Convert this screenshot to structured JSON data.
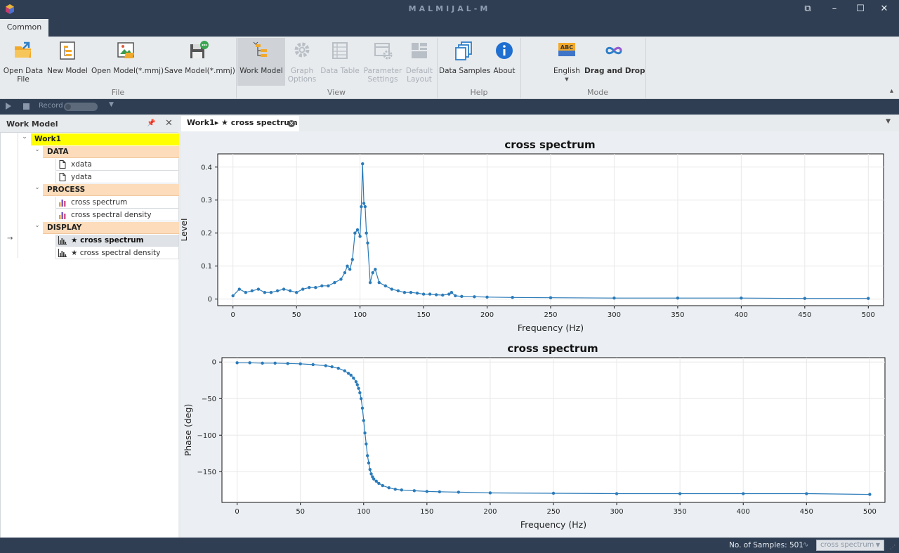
{
  "window": {
    "title": "MALMIJAL-M"
  },
  "ribbon": {
    "tab": "Common",
    "groups": {
      "file": "File",
      "view": "View",
      "help": "Help",
      "mode": "Mode"
    },
    "buttons": {
      "open_data_file": "Open Data\nFile",
      "new_model": "New Model",
      "open_model": "Open Model(*.mmj)",
      "save_model": "Save Model(*.mmj)",
      "work_model": "Work Model",
      "graph_options": "Graph\nOptions",
      "data_table": "Data Table",
      "parameter_settings": "Parameter\nSettings",
      "default_layout": "Default\nLayout",
      "data_samples": "Data Samples",
      "about": "About",
      "english": "English",
      "drag_and_drop": "Drag and Drop",
      "english_badge": "ABC"
    }
  },
  "record_bar": {
    "record_label": "Record"
  },
  "work_model_panel": {
    "title": "Work Model",
    "root": "Work1",
    "groups": [
      {
        "label": "DATA",
        "items": [
          "xdata",
          "ydata"
        ]
      },
      {
        "label": "PROCESS",
        "items": [
          "cross spectrum",
          "cross spectral density"
        ]
      },
      {
        "label": "DISPLAY",
        "items": [
          "★ cross spectrum",
          "★ cross spectral density"
        ]
      }
    ]
  },
  "document": {
    "tab_label": "Work1▸ ★ cross spectrum"
  },
  "status": {
    "samples": "No. of Samples: 501",
    "display_select": "cross spectrum"
  },
  "colors": {
    "titlebar": "#2f3e53",
    "ribbon": "#e8ebee",
    "series": "#2b7bb9",
    "root_highlight": "#ffff00",
    "group_highlight": "#fcdcba"
  },
  "chart_data": [
    {
      "type": "line",
      "title": "cross spectrum",
      "xlabel": "Frequency (Hz)",
      "ylabel": "Level",
      "xlim": [
        -12,
        512
      ],
      "ylim": [
        -0.02,
        0.44
      ],
      "xticks": [
        0,
        50,
        100,
        150,
        200,
        250,
        300,
        350,
        400,
        450,
        500
      ],
      "yticks": [
        0,
        0.1,
        0.2,
        0.3,
        0.4
      ],
      "ytick_labels": [
        "0",
        "0.1",
        "0.2",
        "0.3",
        "0.4"
      ],
      "grid": true,
      "markers": true,
      "x": [
        0,
        5,
        10,
        15,
        20,
        25,
        30,
        35,
        40,
        45,
        50,
        55,
        60,
        65,
        70,
        75,
        80,
        85,
        88,
        90,
        92,
        94,
        96,
        98,
        100,
        101,
        102,
        103,
        104,
        105,
        106,
        108,
        110,
        112,
        115,
        120,
        125,
        130,
        135,
        140,
        145,
        150,
        155,
        160,
        165,
        170,
        172,
        175,
        180,
        190,
        200,
        220,
        250,
        300,
        350,
        400,
        450,
        500
      ],
      "y": [
        0.01,
        0.03,
        0.02,
        0.025,
        0.03,
        0.02,
        0.02,
        0.025,
        0.03,
        0.025,
        0.02,
        0.03,
        0.035,
        0.035,
        0.04,
        0.04,
        0.05,
        0.06,
        0.08,
        0.1,
        0.09,
        0.12,
        0.2,
        0.21,
        0.19,
        0.28,
        0.41,
        0.29,
        0.28,
        0.2,
        0.17,
        0.05,
        0.08,
        0.09,
        0.05,
        0.04,
        0.03,
        0.025,
        0.02,
        0.02,
        0.018,
        0.015,
        0.015,
        0.013,
        0.012,
        0.015,
        0.02,
        0.01,
        0.008,
        0.007,
        0.006,
        0.005,
        0.004,
        0.003,
        0.003,
        0.003,
        0.002,
        0.002
      ]
    },
    {
      "type": "line",
      "title": "cross spectrum",
      "xlabel": "Frequency (Hz)",
      "ylabel": "Phase (deg)",
      "xlim": [
        -12,
        512
      ],
      "ylim": [
        -192,
        6
      ],
      "xticks": [
        0,
        50,
        100,
        150,
        200,
        250,
        300,
        350,
        400,
        450,
        500
      ],
      "yticks": [
        0,
        -50,
        -100,
        -150
      ],
      "ytick_labels": [
        "0",
        "−50",
        "−100",
        "−150"
      ],
      "grid": true,
      "markers": true,
      "x": [
        0,
        10,
        20,
        30,
        40,
        50,
        60,
        70,
        75,
        80,
        85,
        88,
        90,
        92,
        94,
        95,
        96,
        97,
        98,
        99,
        100,
        101,
        102,
        103,
        104,
        105,
        106,
        107,
        108,
        110,
        112,
        115,
        120,
        125,
        130,
        140,
        150,
        160,
        175,
        200,
        250,
        300,
        350,
        400,
        450,
        500
      ],
      "y": [
        -1,
        -1,
        -1.5,
        -1.5,
        -2,
        -2.5,
        -3.5,
        -5,
        -6.5,
        -8.5,
        -12,
        -15.5,
        -18,
        -22,
        -27,
        -31,
        -36,
        -42,
        -50,
        -63,
        -80,
        -97,
        -112,
        -128,
        -138,
        -147,
        -153,
        -157,
        -160,
        -163,
        -166,
        -169,
        -172,
        -174,
        -175,
        -176,
        -177,
        -177.5,
        -178,
        -179,
        -179.5,
        -180,
        -180,
        -180,
        -180,
        -181
      ]
    }
  ]
}
